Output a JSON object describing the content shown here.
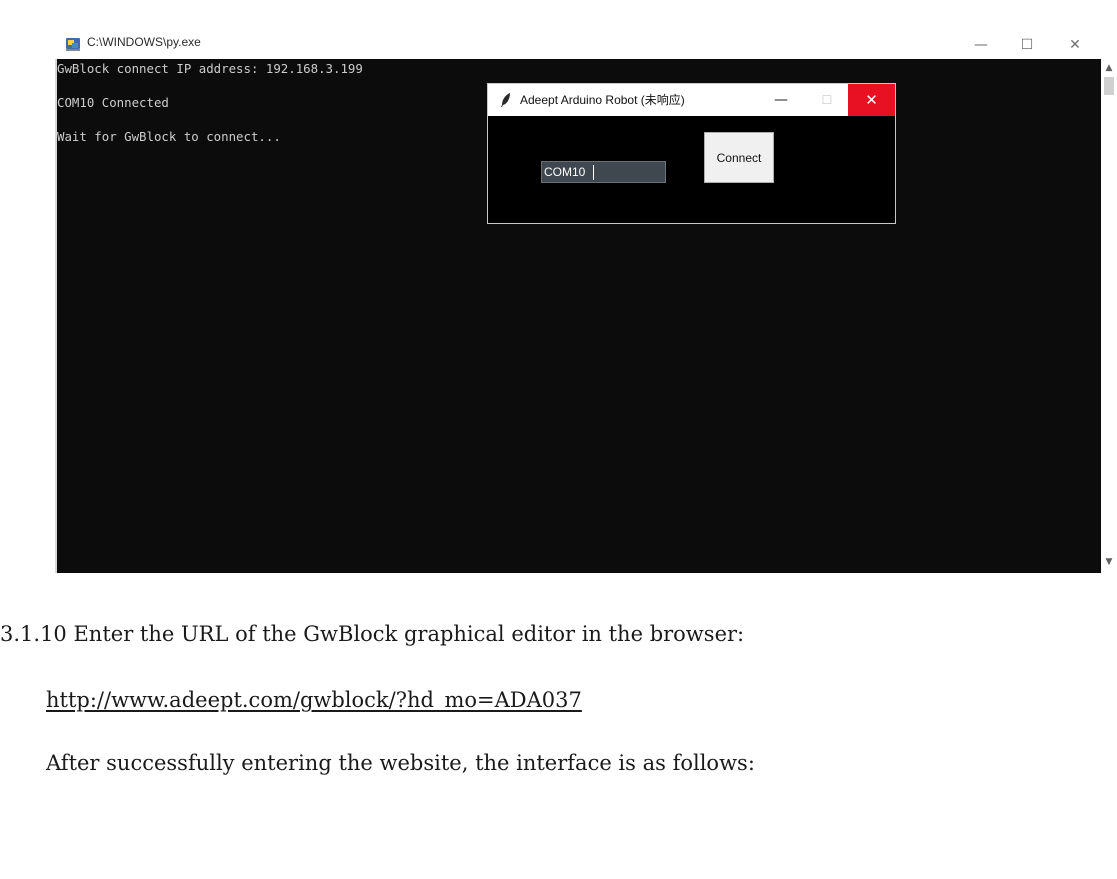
{
  "console_window": {
    "title": "C:\\WINDOWS\\py.exe",
    "icon": "python-icon",
    "controls": {
      "minimize": "—",
      "maximize": "☐",
      "close": "✕"
    },
    "lines": [
      "GwBlock connect IP address: 192.168.3.199",
      "COM10 Connected",
      "Wait for GwBlock to connect..."
    ],
    "colors": {
      "background": "#0c0c0c",
      "text": "#cccccc"
    }
  },
  "dialog": {
    "title": "Adeept Arduino Robot (未响应)",
    "icon": "feather-icon",
    "controls": {
      "minimize": "—",
      "maximize": "☐",
      "close": "✕"
    },
    "port_value": "COM10",
    "connect_label": "Connect",
    "colors": {
      "background": "#000000",
      "close": "#e81123",
      "entry": "#40484f"
    }
  },
  "document": {
    "step_heading": "3.1.10  Enter the URL of the GwBlock graphical editor in the browser:",
    "url": "http://www.adeept.com/gwblock/?hd_mo=ADA037",
    "followup": "After successfully entering the website, the interface is as follows:"
  }
}
